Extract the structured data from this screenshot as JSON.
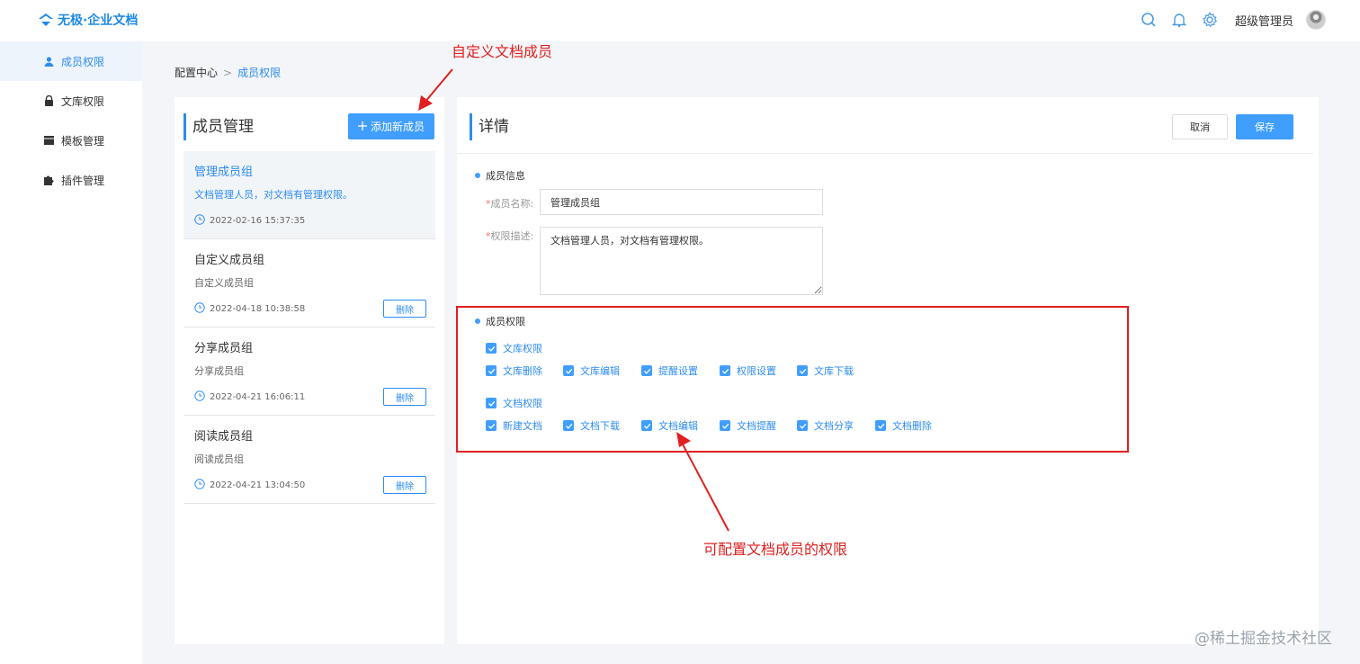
{
  "app": {
    "logo_text": "无极·企业文档"
  },
  "header": {
    "user_name": "超级管理员"
  },
  "sidebar": {
    "items": [
      {
        "label": "成员权限",
        "icon": "user-icon"
      },
      {
        "label": "文库权限",
        "icon": "lock-icon"
      },
      {
        "label": "模板管理",
        "icon": "template-icon"
      },
      {
        "label": "插件管理",
        "icon": "puzzle-icon"
      }
    ]
  },
  "breadcrumb": {
    "root": "配置中心",
    "separator": ">",
    "current": "成员权限"
  },
  "members": {
    "title": "成员管理",
    "add_label": "添加新成员",
    "groups": [
      {
        "name": "管理成员组",
        "desc": "文档管理人员，对文档有管理权限。",
        "time": "2022-02-16 15:37:35"
      },
      {
        "name": "自定义成员组",
        "desc": "自定义成员组",
        "time": "2022-04-18 10:38:58",
        "delete_label": "删除"
      },
      {
        "name": "分享成员组",
        "desc": "分享成员组",
        "time": "2022-04-21 16:06:11",
        "delete_label": "删除"
      },
      {
        "name": "阅读成员组",
        "desc": "阅读成员组",
        "time": "2022-04-21 13:04:50",
        "delete_label": "删除"
      }
    ]
  },
  "detail": {
    "title": "详情",
    "cancel_label": "取消",
    "save_label": "保存",
    "info_section": "成员信息",
    "name_label": "成员名称:",
    "name_value": "管理成员组",
    "desc_label": "权限描述:",
    "desc_value": "文档管理人员，对文档有管理权限。",
    "perm_section": "成员权限",
    "library_perm": {
      "label": "文库权限",
      "checked": true
    },
    "library_items": [
      {
        "label": "文库删除",
        "checked": true
      },
      {
        "label": "文库编辑",
        "checked": true
      },
      {
        "label": "提醒设置",
        "checked": true
      },
      {
        "label": "权限设置",
        "checked": true
      },
      {
        "label": "文库下载",
        "checked": true
      }
    ],
    "doc_perm": {
      "label": "文档权限",
      "checked": true
    },
    "doc_items": [
      {
        "label": "新建文档",
        "checked": true
      },
      {
        "label": "文档下载",
        "checked": true
      },
      {
        "label": "文档编辑",
        "checked": true
      },
      {
        "label": "文档提醒",
        "checked": true
      },
      {
        "label": "文档分享",
        "checked": true
      },
      {
        "label": "文档删除",
        "checked": true
      }
    ]
  },
  "annotations": {
    "custom_member": "自定义文档成员",
    "configure_perm": "可配置文档成员的权限"
  },
  "watermark": "@稀土掘金技术社区",
  "colors": {
    "accent": "#409eff",
    "annotation": "#e02020"
  }
}
